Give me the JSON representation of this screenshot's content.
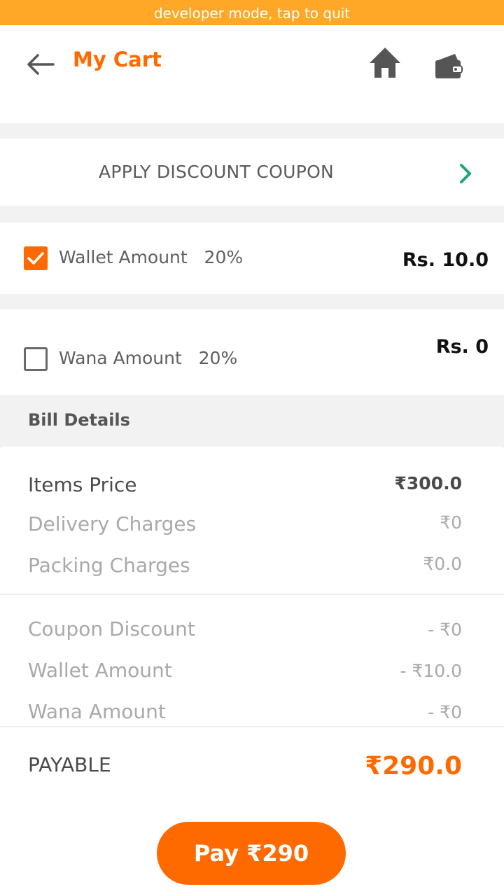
{
  "system": {
    "dev_banner": "developer mode, tap to quit"
  },
  "header": {
    "title": "My Cart",
    "icons": [
      "arrow-left-icon",
      "home-icon",
      "wallet-icon"
    ]
  },
  "coupon": {
    "label": "APPLY DISCOUNT COUPON",
    "icon": "chevron-right-icon"
  },
  "wallet_option": {
    "label": "Wallet Amount   20%",
    "amount": "Rs. 10.0",
    "checked": true
  },
  "wana_option": {
    "label": "Wana Amount   20%",
    "amount": "Rs. 0",
    "checked": false
  },
  "bill": {
    "title": "Bill Details",
    "items": [
      {
        "label": "Items Price",
        "value": "₹300.0"
      },
      {
        "label": "Delivery Charges",
        "value": "₹0"
      },
      {
        "label": "Packing Charges",
        "value": "₹0.0"
      },
      {
        "label": "Coupon Discount",
        "value": "- ₹0"
      },
      {
        "label": "Wallet Amount",
        "value": "- ₹10.0"
      },
      {
        "label": "Wana Amount",
        "value": "- ₹0"
      }
    ],
    "payable_label": "PAYABLE",
    "payable_value": "₹290.0"
  },
  "pay_button": {
    "label": "Pay ₹290"
  },
  "colors": {
    "accent": "#FF6A00",
    "banner": "#FFA726",
    "chevron": "#1BA672",
    "section_gap": "#F2F2F2"
  }
}
